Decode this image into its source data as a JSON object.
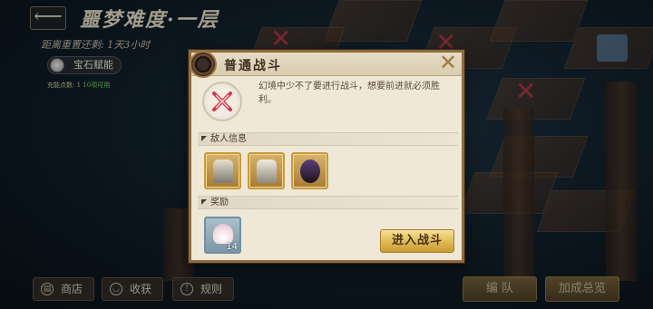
{
  "header": {
    "back_label": "⟵",
    "title": "噩梦难度·一层",
    "reset_text": "距离重置还剩: 1天3小时",
    "gem_talent_label": "宝石赋能",
    "charge_label": "充能点数: 1",
    "charge_available": "10项可用"
  },
  "bottom_bar": {
    "shop_label": "商店",
    "harvest_label": "收获",
    "rules_label": "规则",
    "team_label": "编 队",
    "bonus_label": "加成总览"
  },
  "dialog": {
    "title": "普通战斗",
    "description": "幻境中少不了要进行战斗，想要前进就必须胜利。",
    "enemy_section_label": "敌人信息",
    "reward_section_label": "奖励",
    "reward_count": "14",
    "enter_button_label": "进入战斗"
  },
  "colors": {
    "accent_gold": "#dcb74e",
    "battle_red": "#d8344a",
    "dialog_bg": "#efe8d6"
  },
  "icons": {
    "back": "arrow-left-icon",
    "close": "close-icon",
    "battle": "crossed-swords-icon",
    "gem": "gem-icon",
    "shop": "shop-icon",
    "harvest": "basket-icon",
    "rules": "exclamation-icon",
    "reward": "seashell-icon"
  }
}
